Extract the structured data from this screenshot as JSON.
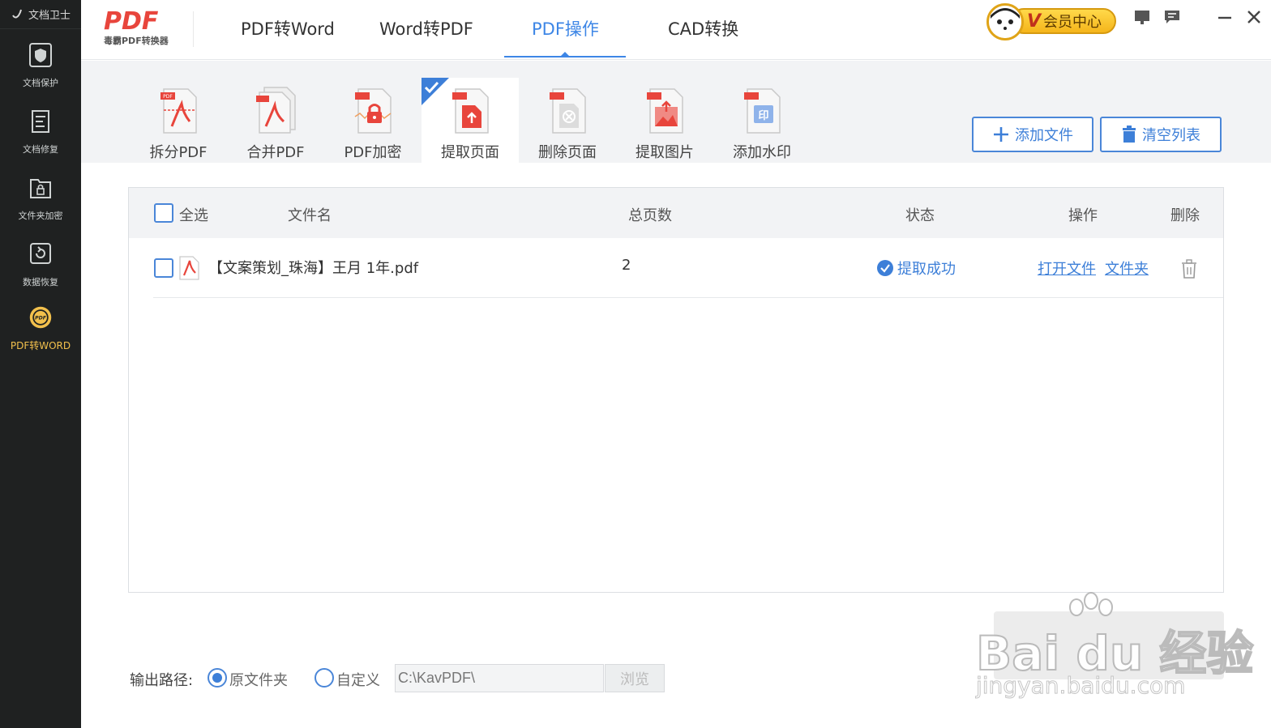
{
  "sidebar": {
    "brand": "文档卫士",
    "items": [
      {
        "label": "文档保护",
        "icon": "shield-icon"
      },
      {
        "label": "文档修复",
        "icon": "document-repair-icon"
      },
      {
        "label": "文件夹加密",
        "icon": "folder-lock-icon"
      },
      {
        "label": "数据恢复",
        "icon": "data-recovery-icon"
      },
      {
        "label": "PDF转WORD",
        "icon": "pdf-badge-icon",
        "active": true
      }
    ]
  },
  "header": {
    "logo_text": "PDF",
    "logo_sub": "毒霸PDF转换器",
    "tabs": [
      {
        "label": "PDF转Word"
      },
      {
        "label": "Word转PDF"
      },
      {
        "label": "PDF操作",
        "active": true
      },
      {
        "label": "CAD转换"
      }
    ],
    "vip_label": "会员中心",
    "vip_v": "V"
  },
  "toolbar": {
    "tools": [
      {
        "label": "拆分PDF"
      },
      {
        "label": "合并PDF"
      },
      {
        "label": "PDF加密"
      },
      {
        "label": "提取页面",
        "active": true
      },
      {
        "label": "删除页面"
      },
      {
        "label": "提取图片"
      },
      {
        "label": "添加水印"
      }
    ],
    "add_file": "添加文件",
    "clear_list": "清空列表"
  },
  "table": {
    "headers": {
      "select_all": "全选",
      "filename": "文件名",
      "pages": "总页数",
      "status": "状态",
      "actions": "操作",
      "delete": "删除"
    },
    "rows": [
      {
        "filename": "【文案策划_珠海】王月 1年.pdf",
        "pages": "2",
        "status": "提取成功",
        "open_file": "打开文件",
        "folder": "文件夹"
      }
    ]
  },
  "output": {
    "label": "输出路径:",
    "option_original": "原文件夹",
    "option_custom": "自定义",
    "path": "C:\\KavPDF\\",
    "browse": "浏览"
  },
  "watermark": {
    "text": "Bai du 经验",
    "sub": "jingyan.baidu.com"
  },
  "colors": {
    "accent": "#3d86e6",
    "sidebar_bg": "#1f2121",
    "toolbar_bg": "#f2f3f5",
    "vip_gold": "#f5b51b",
    "pdf_red": "#e8453c"
  }
}
